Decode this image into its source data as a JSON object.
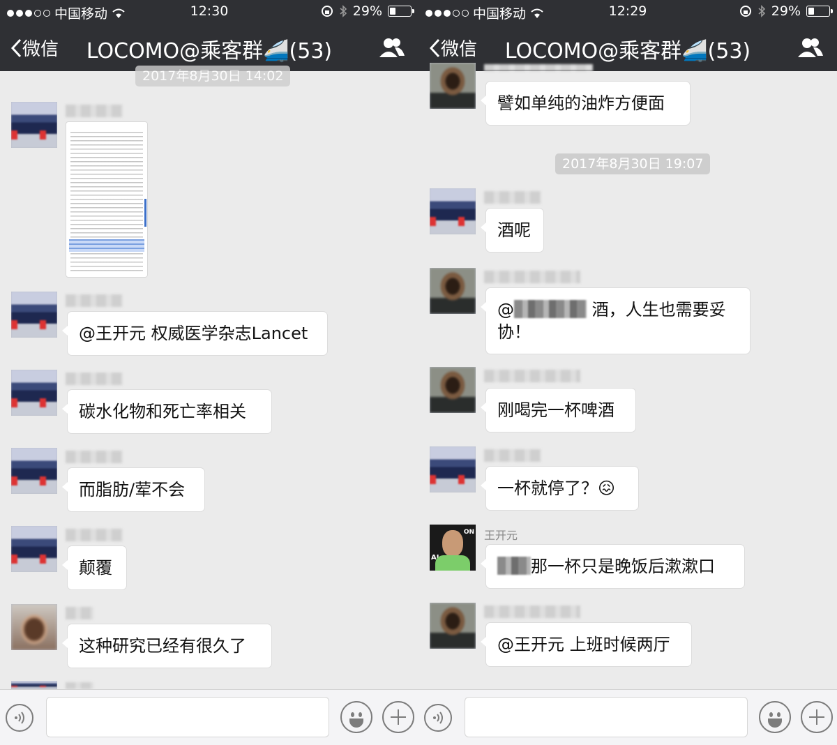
{
  "status_bar": {
    "carrier": "中国移动",
    "battery": "29%",
    "battery_level": 0.29
  },
  "nav": {
    "back_label": "微信",
    "title": "LOCOMO@乘客群🚄(53)"
  },
  "left_pane": {
    "status_time": "12:30",
    "timestamp": "2017年8月30日 14:02",
    "messages": [
      {
        "text": "@王开元 权威医学杂志Lancet"
      },
      {
        "text": "碳水化物和死亡率相关"
      },
      {
        "text": "而脂肪/荤不会"
      },
      {
        "text": "颠覆"
      },
      {
        "text": "这种研究已经有很久了"
      }
    ]
  },
  "right_pane": {
    "status_time": "12:29",
    "top_message": "譬如单纯的油炸方便面",
    "timestamp": "2017年8月30日 19:07",
    "messages": [
      {
        "text": "酒呢"
      },
      {
        "prefix": "@",
        "text": " 酒，人生也需要妥",
        "text2": "协！"
      },
      {
        "text": "刚喝完一杯啤酒"
      },
      {
        "text": "一杯就停了？😖"
      },
      {
        "sender": "王开元",
        "text": "那一杯只是晚饭后漱漱口"
      },
      {
        "text": "@王开元 上班时候两厅"
      }
    ]
  },
  "colors": {
    "nav_bg": "#2f3034",
    "chat_bg": "#ebebeb",
    "bubble_bg": "#ffffff",
    "timestamp_bg": "#cecece"
  }
}
